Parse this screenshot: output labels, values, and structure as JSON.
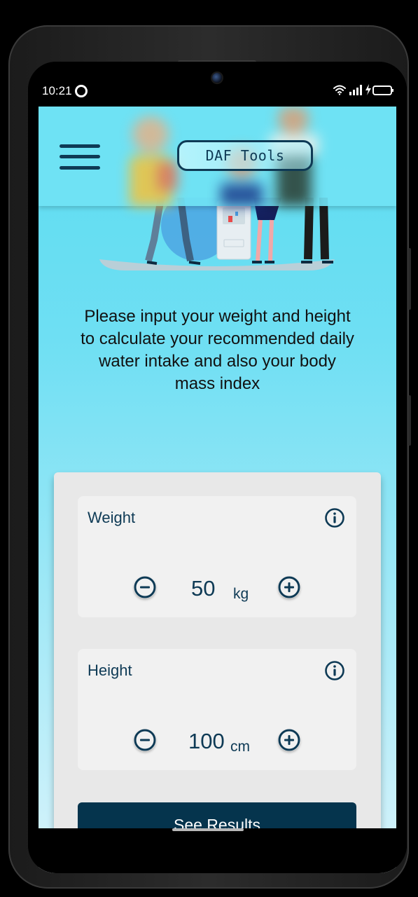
{
  "status_bar": {
    "time": "10:21"
  },
  "header": {
    "logo_text": "DAF Tools"
  },
  "intro_text": "Please input your weight and height to calculate your recommended daily water intake and also your body mass index",
  "weight": {
    "label": "Weight",
    "value": "50",
    "unit": "kg"
  },
  "height": {
    "label": "Height",
    "value": "100",
    "unit": "cm"
  },
  "results_button": "See Results",
  "colors": {
    "primary": "#05344d",
    "accent": "#5ddcf1"
  },
  "icons": [
    "menu-icon",
    "info-icon",
    "minus-circle-icon",
    "plus-circle-icon",
    "wifi-icon",
    "signal-icon",
    "battery-icon"
  ]
}
